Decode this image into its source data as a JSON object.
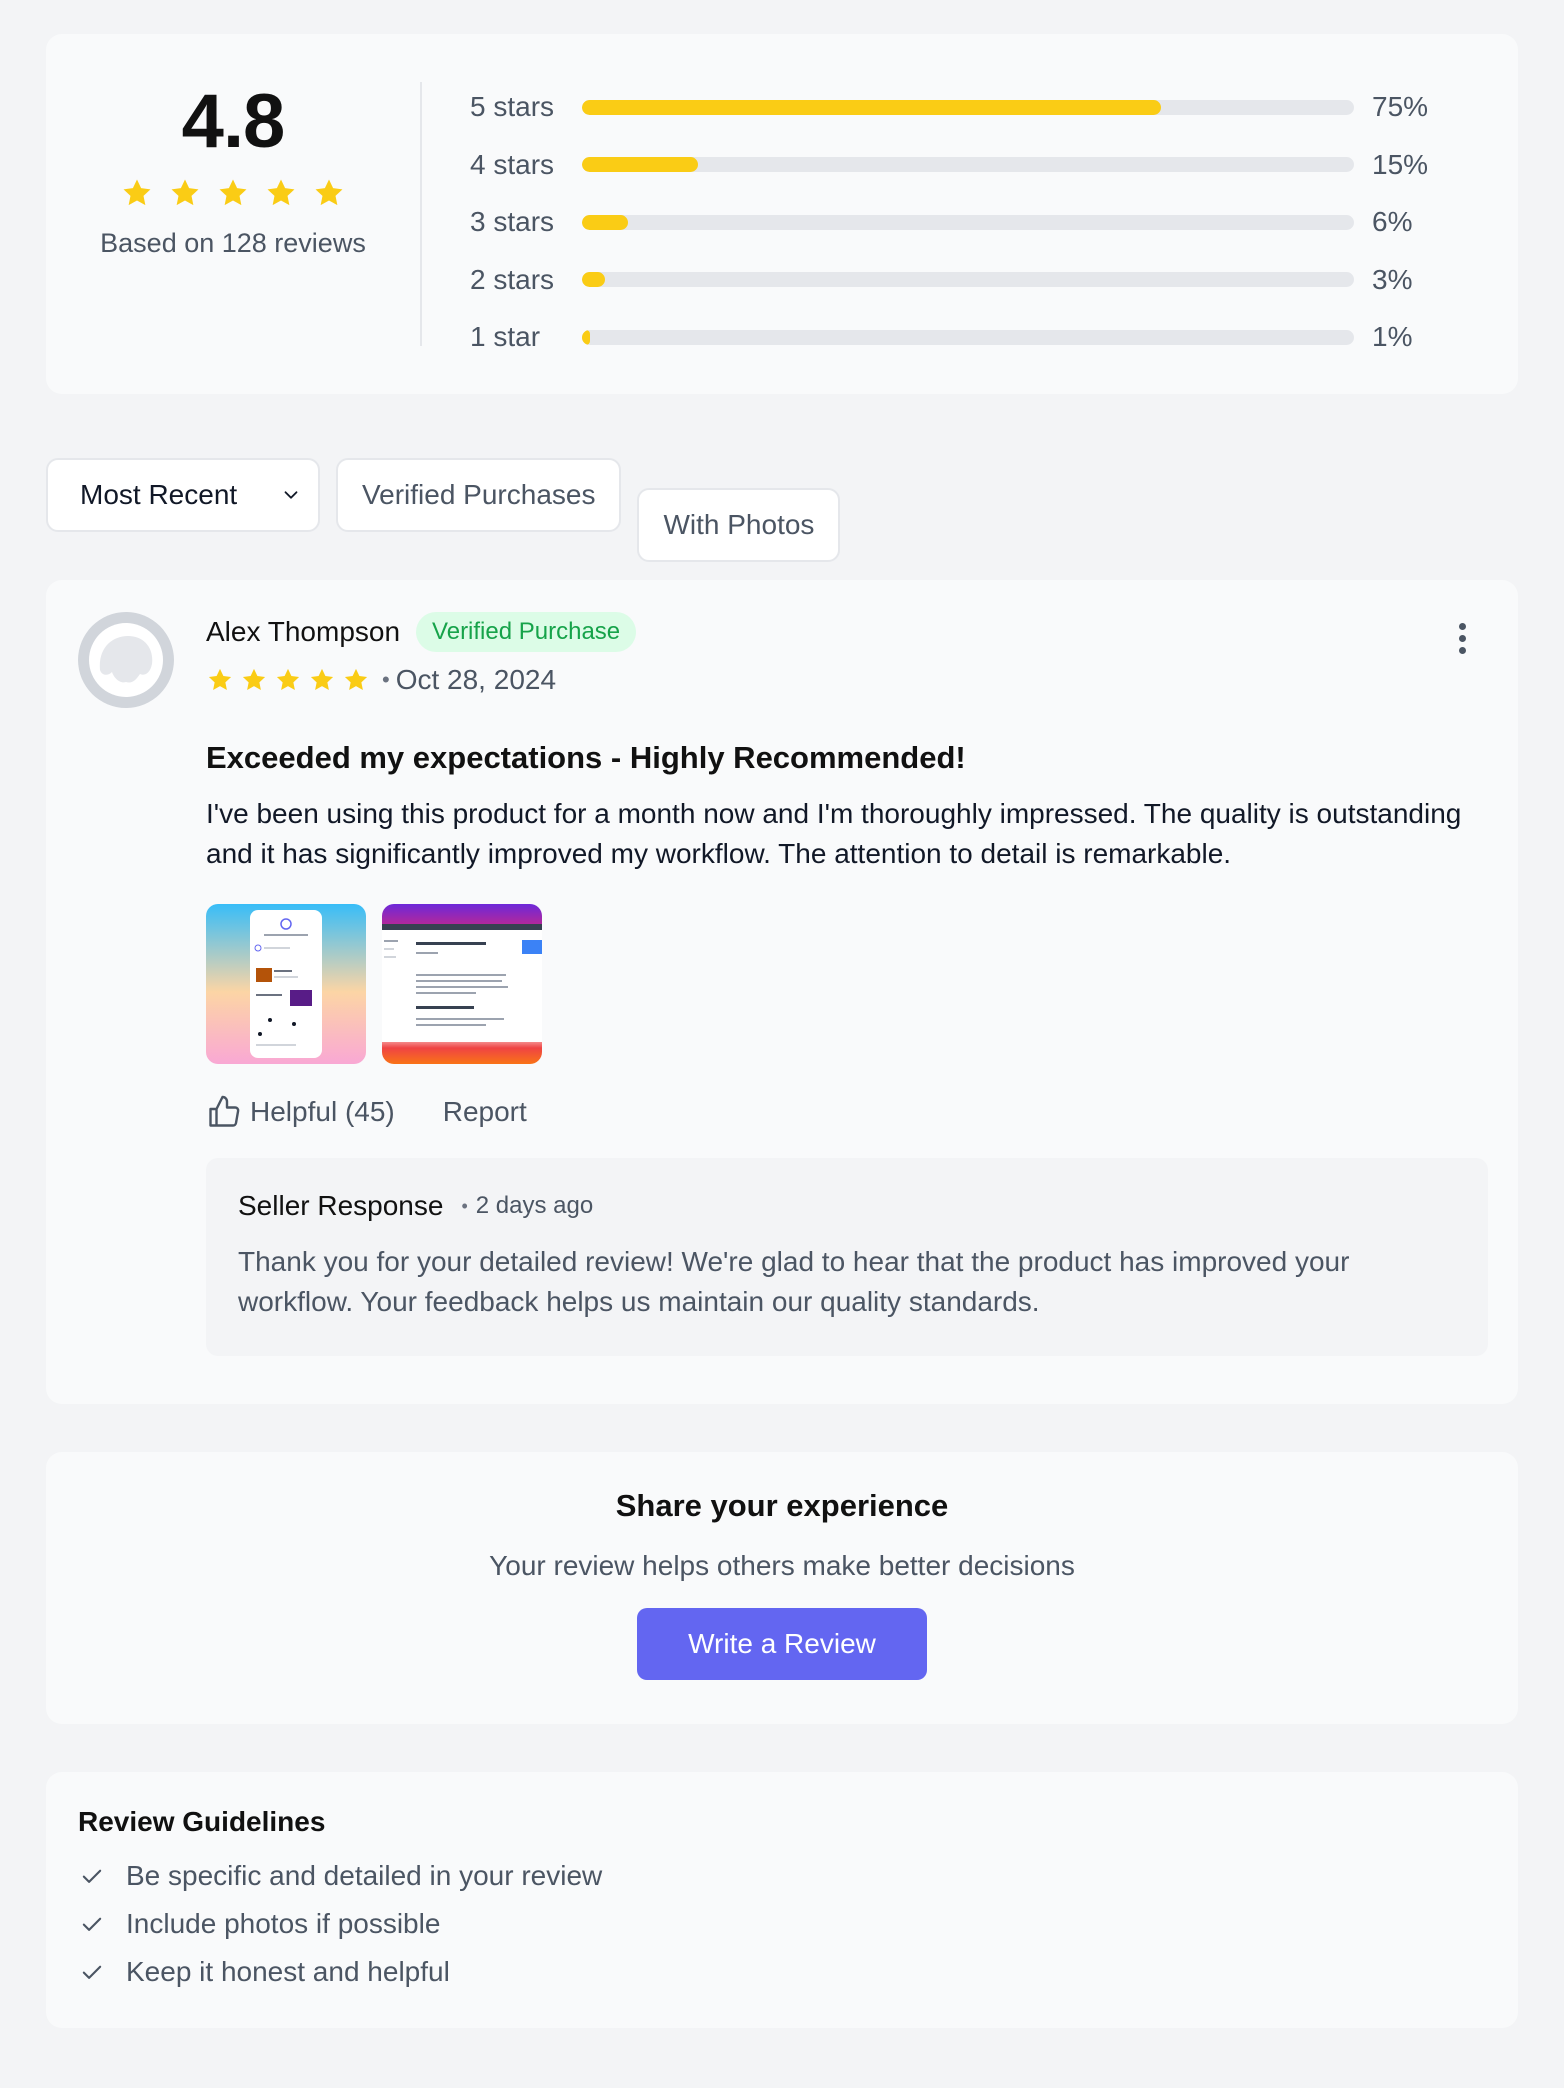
{
  "summary": {
    "average": "4.8",
    "star_count": 5,
    "based_on": "Based on 128 reviews",
    "distribution": [
      {
        "label": "5 stars",
        "percent_text": "75%",
        "percent": 75
      },
      {
        "label": "4 stars",
        "percent_text": "15%",
        "percent": 15
      },
      {
        "label": "3 stars",
        "percent_text": "6%",
        "percent": 6
      },
      {
        "label": "2 stars",
        "percent_text": "3%",
        "percent": 3
      },
      {
        "label": "1 star",
        "percent_text": "1%",
        "percent": 1
      }
    ]
  },
  "filters": {
    "sort_selected": "Most Recent",
    "buttons": [
      "Verified Purchases",
      "With Photos"
    ]
  },
  "review": {
    "author": "Alex Thompson",
    "badge": "Verified Purchase",
    "rating": 5,
    "date_separator": "•",
    "date": "Oct 28, 2024",
    "title": "Exceeded my expectations - Highly Recommended!",
    "text": "I've been using this product for a month now and I'm thoroughly impressed. The quality is outstanding and it has significantly improved my workflow. The attention to detail is remarkable.",
    "helpful_label": "Helpful (45)",
    "report_label": "Report",
    "seller_response": {
      "label": "Seller Response",
      "separator": "•",
      "time": "2 days ago",
      "text": "Thank you for your detailed review! We're glad to hear that the product has improved your workflow. Your feedback helps us maintain our quality standards."
    }
  },
  "share": {
    "title": "Share your experience",
    "subtitle": "Your review helps others make better decisions",
    "button_label": "Write a Review"
  },
  "guidelines": {
    "title": "Review Guidelines",
    "items": [
      "Be specific and detailed in your review",
      "Include photos if possible",
      "Keep it honest and helpful"
    ]
  },
  "colors": {
    "star": "#facc15",
    "accent": "#6366f1",
    "verified_text": "#16a34a",
    "verified_bg": "#dcfce7"
  },
  "icons": {
    "star": "star-icon",
    "dropdown": "chevron-down-icon",
    "more": "more-vertical-icon",
    "helpful": "thumbs-up-icon",
    "check": "check-icon",
    "avatar": "user-avatar-icon"
  }
}
